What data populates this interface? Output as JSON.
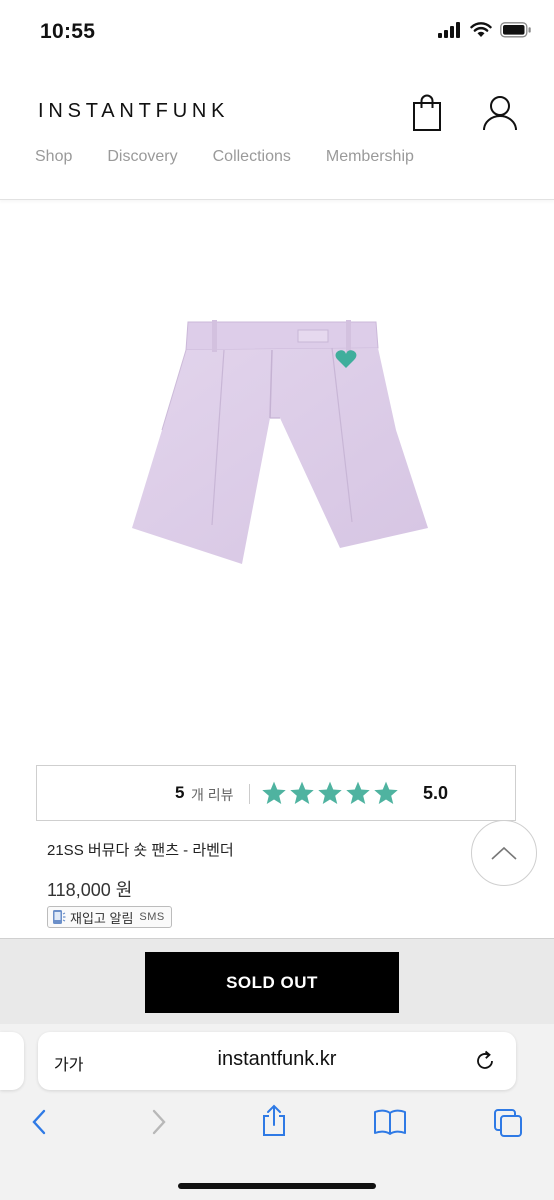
{
  "status_bar": {
    "time": "10:55"
  },
  "header": {
    "logo": "INSTANTFUNK",
    "nav": [
      "Shop",
      "Discovery",
      "Collections",
      "Membership"
    ]
  },
  "product": {
    "image_icon": "lavender-shorts-image",
    "review_count": "5",
    "review_label": "개 리뷰",
    "rating_value": 5.0,
    "rating_text": "5.0",
    "star_color": "#4fb3a0",
    "name": "21SS 버뮤다 숏 팬츠 - 라벤더",
    "price": "118,000 원",
    "restock_label": "재입고 알림",
    "restock_sms": "SMS"
  },
  "cta": {
    "label": "SOLD OUT"
  },
  "browser": {
    "text_size_button": "가가",
    "url": "instantfunk.kr"
  }
}
